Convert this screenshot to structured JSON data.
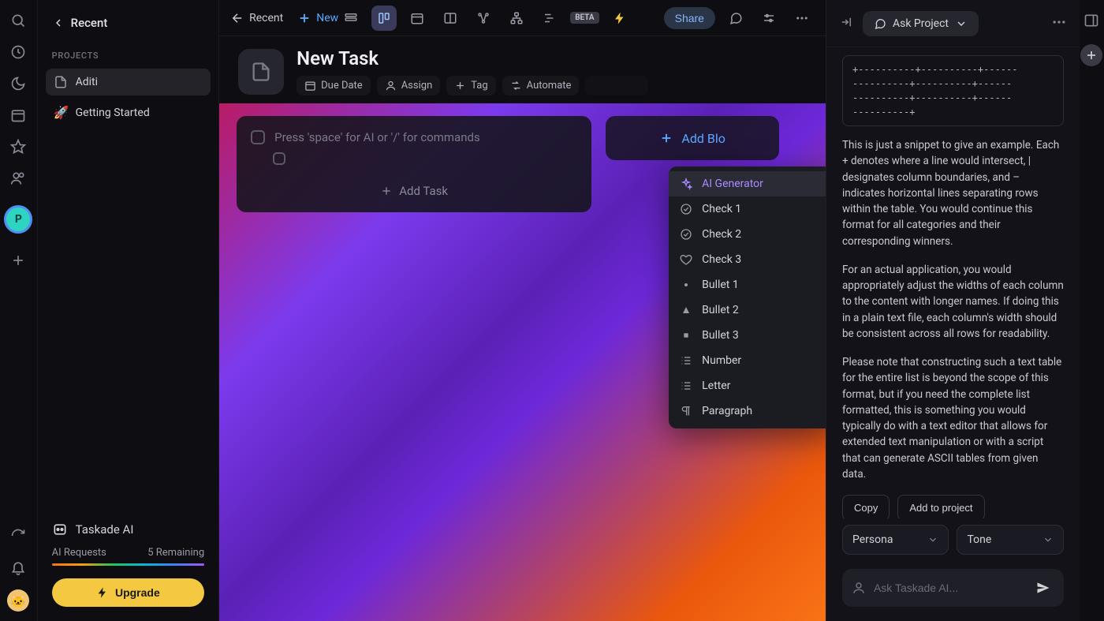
{
  "rail": {
    "avatar_initial": "P"
  },
  "sidebar": {
    "recent_label": "Recent",
    "projects_label": "PROJECTS",
    "projects": [
      {
        "label": "Aditi",
        "active": true,
        "icon": "file"
      },
      {
        "label": "Getting Started",
        "active": false,
        "icon": "rocket"
      }
    ],
    "taskade_ai": "Taskade AI",
    "ai_requests_label": "AI Requests",
    "ai_remaining": "5 Remaining",
    "upgrade": "Upgrade"
  },
  "topbar": {
    "recent": "Recent",
    "new": "New",
    "beta": "BETA",
    "share": "Share"
  },
  "task": {
    "title": "New Task",
    "meta": {
      "due": "Due Date",
      "assign": "Assign",
      "tag": "Tag",
      "automate": "Automate"
    },
    "placeholder": "Press 'space' for AI or '/' for commands",
    "add_task": "Add Task",
    "add_block": "Add Blo"
  },
  "slash_menu": [
    {
      "label": "AI Generator",
      "icon": "sparkle",
      "active": true
    },
    {
      "label": "Check 1",
      "icon": "check-circle"
    },
    {
      "label": "Check 2",
      "icon": "check-done"
    },
    {
      "label": "Check 3",
      "icon": "heart"
    },
    {
      "label": "Bullet 1",
      "icon": "dot"
    },
    {
      "label": "Bullet 2",
      "icon": "triangle"
    },
    {
      "label": "Bullet 3",
      "icon": "square"
    },
    {
      "label": "Number",
      "icon": "number-list"
    },
    {
      "label": "Letter",
      "icon": "number-list"
    },
    {
      "label": "Paragraph",
      "icon": "paragraph"
    }
  ],
  "right": {
    "ask_project": "Ask Project",
    "code_snippet": "+----------+----------+------\n----------+----------+------\n----------+----------+------\n----------+",
    "para1": "This is just a snippet to give an example. Each + denotes where a line would intersect, | designates column boundaries, and – indicates horizontal lines separating rows within the table. You would continue this format for all categories and their corresponding winners.",
    "para2": "For an actual application, you would appropriately adjust the widths of each column to the content with longer names. If doing this in a plain text file, each column's width should be consistent across all rows for readability.",
    "para3": "Please note that constructing such a text table for the entire list is beyond the scope of this format, but if you need the complete list formatted, this is something you would typically do with a text editor that allows for extended text manipulation or with a script that can generate ASCII tables from given data.",
    "copy": "Copy",
    "add_to_project": "Add to project",
    "persona": "Persona",
    "tone": "Tone",
    "input_placeholder": "Ask Taskade AI..."
  }
}
